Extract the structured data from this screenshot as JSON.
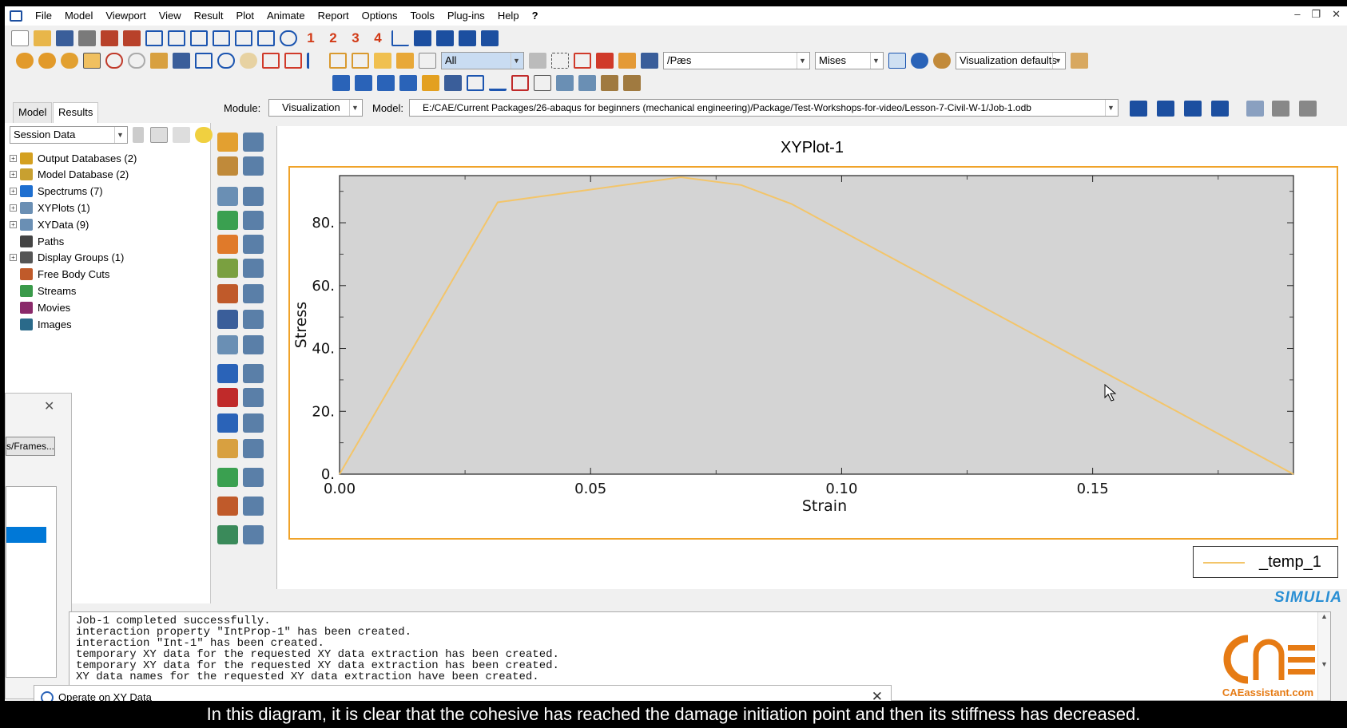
{
  "menu": [
    "File",
    "Model",
    "Viewport",
    "View",
    "Result",
    "Plot",
    "Animate",
    "Report",
    "Options",
    "Tools",
    "Plug-ins",
    "Help",
    "?"
  ],
  "toolbar": {
    "numbers": [
      "1",
      "2",
      "3",
      "4"
    ],
    "selection_filter": "All",
    "variable_combo": "/Pæs",
    "invariant_combo": "Mises",
    "visualization_defaults": "Visualization defaults"
  },
  "context": {
    "tabs": [
      "Model",
      "Results"
    ],
    "module_label": "Module:",
    "module_value": "Visualization",
    "model_label": "Model:",
    "model_path": "E:/CAE/Current Packages/26-abaqus for beginners (mechanical engineering)/Package/Test-Workshops-for-video/Lesson-7-Civil-W-1/Job-1.odb"
  },
  "tree": {
    "combo": "Session Data",
    "items": [
      {
        "label": "Output Databases (2)",
        "expandable": true,
        "icon": "database-icon",
        "color": "#d4a020"
      },
      {
        "label": "Model Database (2)",
        "expandable": true,
        "icon": "database-icon",
        "color": "#c8a030"
      },
      {
        "label": "Spectrums (7)",
        "expandable": true,
        "icon": "spectrum-icon",
        "color": "#1e6fd0"
      },
      {
        "label": "XYPlots (1)",
        "expandable": true,
        "icon": "grid-icon",
        "color": "#6a8fb4"
      },
      {
        "label": "XYData (9)",
        "expandable": true,
        "icon": "grid-icon",
        "color": "#6a8fb4"
      },
      {
        "label": "Paths",
        "expandable": false,
        "icon": "path-icon",
        "color": "#444444"
      },
      {
        "label": "Display Groups (1)",
        "expandable": true,
        "icon": "display-group-icon",
        "color": "#555555"
      },
      {
        "label": "Free Body Cuts",
        "expandable": false,
        "icon": "free-body-icon",
        "color": "#c05a2a"
      },
      {
        "label": "Streams",
        "expandable": false,
        "icon": "stream-icon",
        "color": "#3a9a4a"
      },
      {
        "label": "Movies",
        "expandable": false,
        "icon": "movie-icon",
        "color": "#8a2a6a"
      },
      {
        "label": "Images",
        "expandable": false,
        "icon": "image-icon",
        "color": "#2a6a8a"
      }
    ]
  },
  "dialog_left": {
    "button": "s/Frames..."
  },
  "chart_data": {
    "type": "line",
    "title": "XYPlot-1",
    "xlabel": "Strain",
    "ylabel": "Stress",
    "xlim": [
      0.0,
      0.19
    ],
    "ylim": [
      0.0,
      95.0
    ],
    "x_ticks": [
      "0.00",
      "0.05",
      "0.10",
      "0.15"
    ],
    "x_tick_values": [
      0.0,
      0.05,
      0.1,
      0.15
    ],
    "y_ticks": [
      "0.",
      "20.",
      "40.",
      "60.",
      "80."
    ],
    "y_tick_values": [
      0,
      20,
      40,
      60,
      80
    ],
    "grid": false,
    "legend_position": "bottom-right outside",
    "series": [
      {
        "name": "_temp_1",
        "color": "#f3c56a",
        "x": [
          0.0,
          0.0315,
          0.068,
          0.08,
          0.09,
          0.19
        ],
        "y": [
          0.0,
          86.5,
          94.5,
          92.0,
          86.0,
          0.0
        ]
      }
    ],
    "plot_bg": "#d4d4d4"
  },
  "messages": [
    "Job-1 completed successfully.",
    "interaction property \"IntProp-1\" has been created.",
    "interaction \"Int-1\" has been created.",
    "temporary XY data for the requested XY data extraction has been created.",
    "temporary XY data for the requested XY data extraction has been created.",
    "XY data names for the requested XY data extraction have been created."
  ],
  "operate_dialog": {
    "title": "Operate on XY Data"
  },
  "brand": {
    "simulia": "SIMULIA",
    "watermark": "CAEassistant.com"
  },
  "caption": "In this diagram, it is clear that the cohesive has reached the damage initiation point and then its stiffness has decreased."
}
